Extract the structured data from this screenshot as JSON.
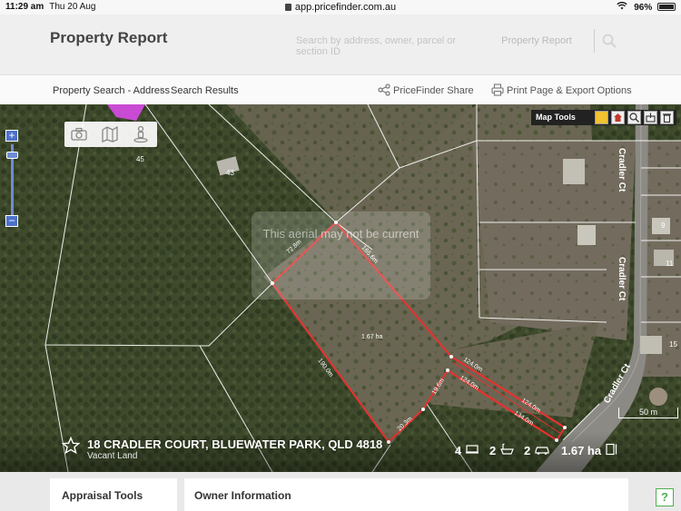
{
  "status_bar": {
    "time": "11:29 am",
    "date": "Thu 20 Aug",
    "url": "app.pricefinder.com.au",
    "battery": "96%"
  },
  "header": {
    "title": "Property Report",
    "search_placeholder": "Search by address, owner, parcel or section ID",
    "search_button": "Property Report"
  },
  "nav": {
    "breadcrumb": [
      "Property Search - Address",
      "Search Results"
    ],
    "share_label": "PriceFinder Share",
    "print_label": "Print Page & Export Options"
  },
  "map": {
    "map_tools_label": "Map Tools",
    "watermark": "This aerial may not be current",
    "scale_label": "50 m",
    "street_labels": [
      "Cradler Ct",
      "Cradler Ct",
      "Cradler Ct"
    ],
    "house_numbers": [
      "45",
      "43",
      "9",
      "11",
      "15"
    ],
    "area_label": "1.67 ha",
    "dimension_labels": [
      "72.8m",
      "165.6m",
      "190.0m",
      "124.0m",
      "124.0m",
      "19.6m",
      "20.3m",
      "124.0m",
      "134.0m"
    ],
    "colors": {
      "boundary": "#e8312f",
      "map_tools_bg": "#222222",
      "zoom": "#4d72c8"
    }
  },
  "property": {
    "address": "18 CRADLER COURT, BLUEWATER PARK, QLD 4818",
    "land_type": "Vacant Land",
    "bedrooms": "4",
    "bathrooms": "2",
    "car_spaces": "2",
    "land_area": "1.67 ha"
  },
  "cards": {
    "appraisal": "Appraisal Tools",
    "owner": "Owner Information"
  },
  "help": "?"
}
